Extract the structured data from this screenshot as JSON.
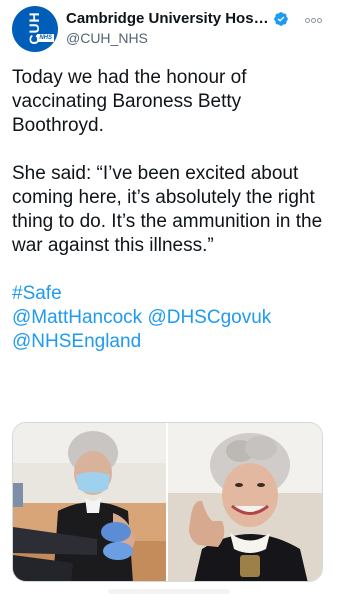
{
  "account": {
    "display_name": "Cambridge University Hospi...",
    "handle": "@CUH_NHS",
    "avatar_text": "CUH",
    "avatar_badge": "NHS",
    "verified": true
  },
  "tweet": {
    "paragraph1": "Today we had the honour of vaccinating Baroness Betty Boothroyd.",
    "paragraph2": "She said: “I’ve been excited about coming here, it’s absolutely the right thing to do. It’s the ammunition in the war against this illness.”",
    "hashtag": "#Safe",
    "mention1": "@MattHancock",
    "mention2": "@DHSCgovuk",
    "mention3": "@NHSEngland"
  },
  "colors": {
    "link": "#1d9bf0",
    "verified": "#1d9bf0",
    "nhs_blue": "#005eb8"
  },
  "icons": {
    "verified": "verified-badge-icon",
    "more": "more-options-icon"
  }
}
